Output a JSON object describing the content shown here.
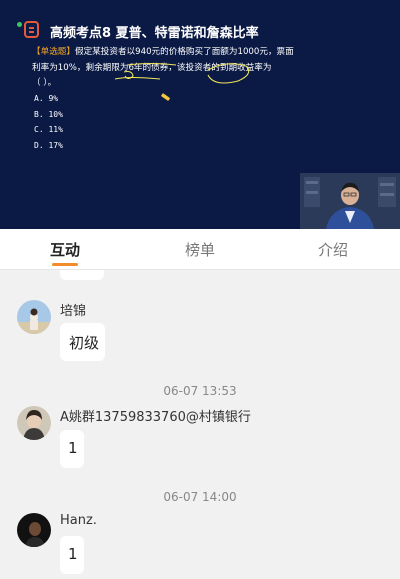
{
  "lesson": {
    "title": "高频考点8 夏普、特雷诺和詹森比率",
    "question_tag": "【单选题】",
    "question_text": "假定某投资者以940元的价格购买了面额为1000元，票面利率为10%，剩余期限为6年的债券，该投资者的到期收益率为",
    "question_paren": "（ ）。",
    "options": [
      "A. 9%",
      "B. 10%",
      "C. 11%",
      "D. 17%"
    ]
  },
  "tabs": [
    {
      "label": "互动",
      "active": true
    },
    {
      "label": "榜单",
      "active": false
    },
    {
      "label": "介绍",
      "active": false
    }
  ],
  "messages": [
    {
      "user": "培锦",
      "text": "初级"
    },
    {
      "time": "06-07 13:53",
      "user": "A姚群13759833760@村镇银行",
      "text": "1"
    },
    {
      "time": "06-07 14:00",
      "user": "Hanz.",
      "text": "1"
    }
  ],
  "colors": {
    "accent": "#f28b2a",
    "video_bg": "#0b1a45",
    "question_tag": "#f5a623"
  }
}
